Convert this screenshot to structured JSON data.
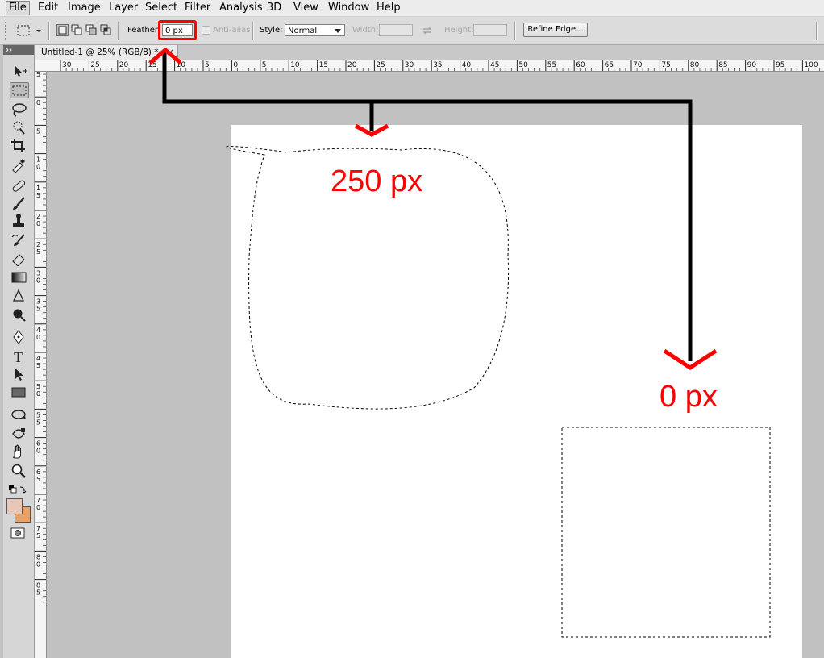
{
  "menubar": {
    "items": [
      {
        "label": "File"
      },
      {
        "label": "Edit"
      },
      {
        "label": "Image"
      },
      {
        "label": "Layer"
      },
      {
        "label": "Select"
      },
      {
        "label": "Filter"
      },
      {
        "label": "Analysis"
      },
      {
        "label": "3D"
      },
      {
        "label": "View"
      },
      {
        "label": "Window"
      },
      {
        "label": "Help"
      }
    ]
  },
  "options": {
    "feather_label": "Feather:",
    "feather_value": "0 px",
    "antialias_label": "Anti-alias",
    "style_label": "Style:",
    "style_value": "Normal",
    "width_label": "Width:",
    "height_label": "Height:",
    "refine_edge_label": "Refine Edge..."
  },
  "document": {
    "tab_title": "Untitled-1 @ 25% (RGB/8) *",
    "ruler_h_labels": [
      "30",
      "25",
      "20",
      "15",
      "10",
      "5",
      "0",
      "5",
      "10",
      "15",
      "20",
      "25",
      "30",
      "35",
      "40",
      "45",
      "50",
      "55",
      "60",
      "65",
      "70",
      "75",
      "80",
      "85",
      "90",
      "95",
      "100"
    ],
    "ruler_v_labels": [
      "5",
      "0",
      "5",
      "1 0",
      "1 5",
      "2 0",
      "2 5",
      "3 0",
      "3 5",
      "4 0",
      "4 5",
      "5 0",
      "5 5",
      "6 0",
      "6 5",
      "7 0",
      "7 5",
      "8 0",
      "8 5"
    ]
  },
  "annotations": {
    "feather_250": "250 px",
    "feather_0": "0 px"
  },
  "colors": {
    "annotation_red": "#ff0000",
    "foreground_color": "#e8c7b8",
    "background_color": "#e8a265"
  },
  "tools": [
    {
      "icon": "move-tool-icon"
    },
    {
      "icon": "rectangular-marquee-tool-icon"
    },
    {
      "icon": "lasso-tool-icon"
    },
    {
      "icon": "quick-selection-tool-icon"
    },
    {
      "icon": "crop-tool-icon"
    },
    {
      "icon": "eyedropper-tool-icon"
    },
    {
      "icon": "healing-brush-tool-icon"
    },
    {
      "icon": "brush-tool-icon"
    },
    {
      "icon": "clone-stamp-tool-icon"
    },
    {
      "icon": "history-brush-tool-icon"
    },
    {
      "icon": "eraser-tool-icon"
    },
    {
      "icon": "gradient-tool-icon"
    },
    {
      "icon": "blur-tool-icon"
    },
    {
      "icon": "dodge-tool-icon"
    },
    {
      "icon": "pen-tool-icon"
    },
    {
      "icon": "type-tool-icon"
    },
    {
      "icon": "path-selection-tool-icon"
    },
    {
      "icon": "rectangle-shape-tool-icon"
    },
    {
      "icon": "3d-rotate-tool-icon"
    },
    {
      "icon": "3d-orbit-tool-icon"
    },
    {
      "icon": "hand-tool-icon"
    },
    {
      "icon": "zoom-tool-icon"
    }
  ]
}
